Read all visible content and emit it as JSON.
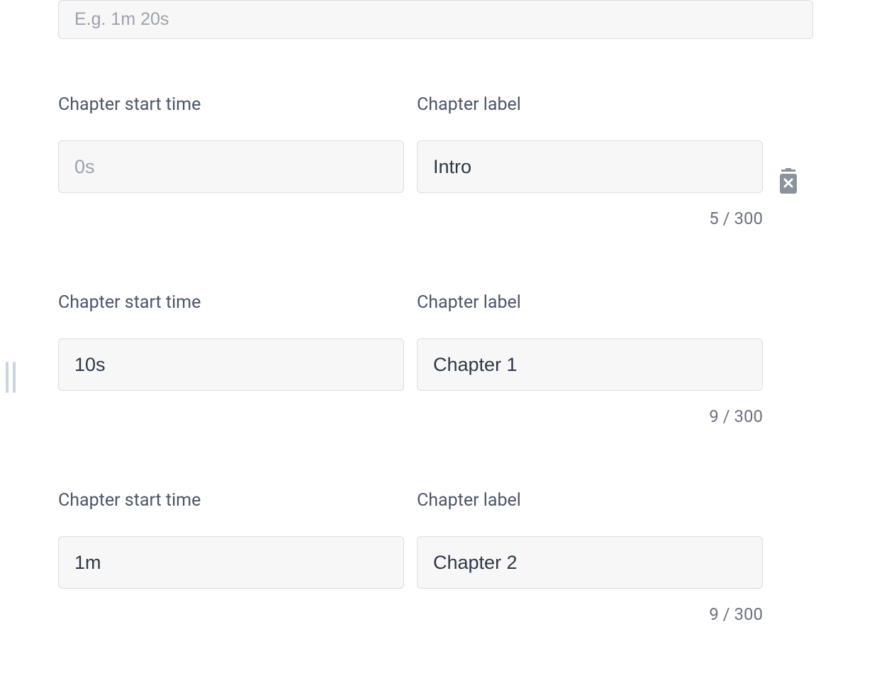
{
  "top_input": {
    "placeholder": "E.g. 1m 20s",
    "value": ""
  },
  "field_labels": {
    "start_time": "Chapter start time",
    "chapter_label": "Chapter label"
  },
  "chapters": [
    {
      "start_value": "",
      "start_placeholder": "0s",
      "label_value": "Intro",
      "counter": "5 / 300",
      "show_delete": true,
      "show_drag": false
    },
    {
      "start_value": "10s",
      "start_placeholder": "",
      "label_value": "Chapter 1",
      "counter": "9 / 300",
      "show_delete": false,
      "show_drag": true
    },
    {
      "start_value": "1m",
      "start_placeholder": "",
      "label_value": "Chapter 2",
      "counter": "9 / 300",
      "show_delete": false,
      "show_drag": false
    }
  ]
}
